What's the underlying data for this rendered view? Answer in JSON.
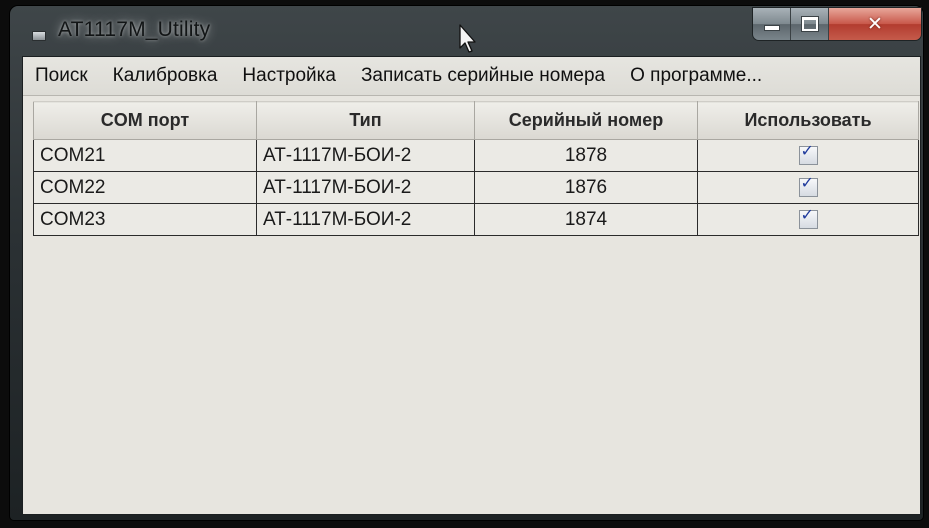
{
  "window": {
    "title": "AT1117M_Utility",
    "close_glyph": "✕"
  },
  "menu": {
    "items": [
      {
        "label": "Поиск"
      },
      {
        "label": "Калибровка"
      },
      {
        "label": "Настройка"
      },
      {
        "label": "Записать серийные номера"
      },
      {
        "label": "О программе..."
      }
    ]
  },
  "table": {
    "columns": [
      "COM порт",
      "Тип",
      "Серийный номер",
      "Использовать"
    ],
    "rows": [
      {
        "port": "COM21",
        "type": "АТ-1117М-БОИ-2",
        "serial": "1878",
        "use": true
      },
      {
        "port": "COM22",
        "type": "АТ-1117М-БОИ-2",
        "serial": "1876",
        "use": true
      },
      {
        "port": "COM23",
        "type": "АТ-1117М-БОИ-2",
        "serial": "1874",
        "use": true
      }
    ]
  },
  "icons": {
    "app": "app-window-icon",
    "minimize": "minimize-icon",
    "maximize": "maximize-icon",
    "close": "close-icon",
    "cursor": "mouse-pointer-icon",
    "check": "checkmark-icon"
  },
  "colors": {
    "client_background": "#e7e5df",
    "close_button": "#c8584a",
    "checkmark": "#1e3a9c"
  }
}
